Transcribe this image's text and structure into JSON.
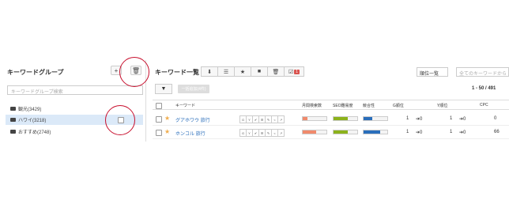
{
  "left": {
    "title": "キーワードグループ",
    "add_icon": "plus-icon",
    "trash_icon": "trash-icon",
    "search_placeholder": "キーワードグループ検索",
    "groups": [
      {
        "label": "観光(3429)"
      },
      {
        "label": "ハワイ(3218)"
      },
      {
        "label": "おすすめ(2748)"
      }
    ]
  },
  "right": {
    "title": "キーワード一覧",
    "toolbar": [
      "download-icon",
      "list-icon",
      "star-icon",
      "folder-icon",
      "trash-icon",
      "check-icon"
    ],
    "badge": "1",
    "sort_label": "順位一覧",
    "search_placeholder": "全てのキーワードから",
    "bulk_label": "一括追加(4件)",
    "pagination": "1 - 50 / 491",
    "columns": [
      "キーワード",
      "月間検索数",
      "SEO難易度",
      "競合性",
      "G順位",
      "Y順位",
      "CPC"
    ],
    "rows": [
      {
        "keyword": "グアホワウ 旅行",
        "actions": [
          "G",
          "Y"
        ],
        "g_rank": "1",
        "g_change": "0",
        "y_rank": "1",
        "y_change": "0",
        "cpc": "0",
        "volume": 0.2,
        "seo": 0.6,
        "competition": 0.35
      },
      {
        "keyword": "ホンコル 旅行",
        "actions": [
          "G",
          "Y"
        ],
        "g_rank": "1",
        "g_change": "0",
        "y_rank": "1",
        "y_change": "0",
        "cpc": "66",
        "volume": 0.55,
        "seo": 0.6,
        "competition": 0.7
      }
    ]
  },
  "colors": {
    "accent": "#2a6ebb",
    "badge": "#d9534f",
    "selected": "#dbe9f8",
    "highlight": "#c8102e",
    "seo": "#8cb21c",
    "volume": "#f08a6c",
    "competition": "#2a6ebb"
  }
}
